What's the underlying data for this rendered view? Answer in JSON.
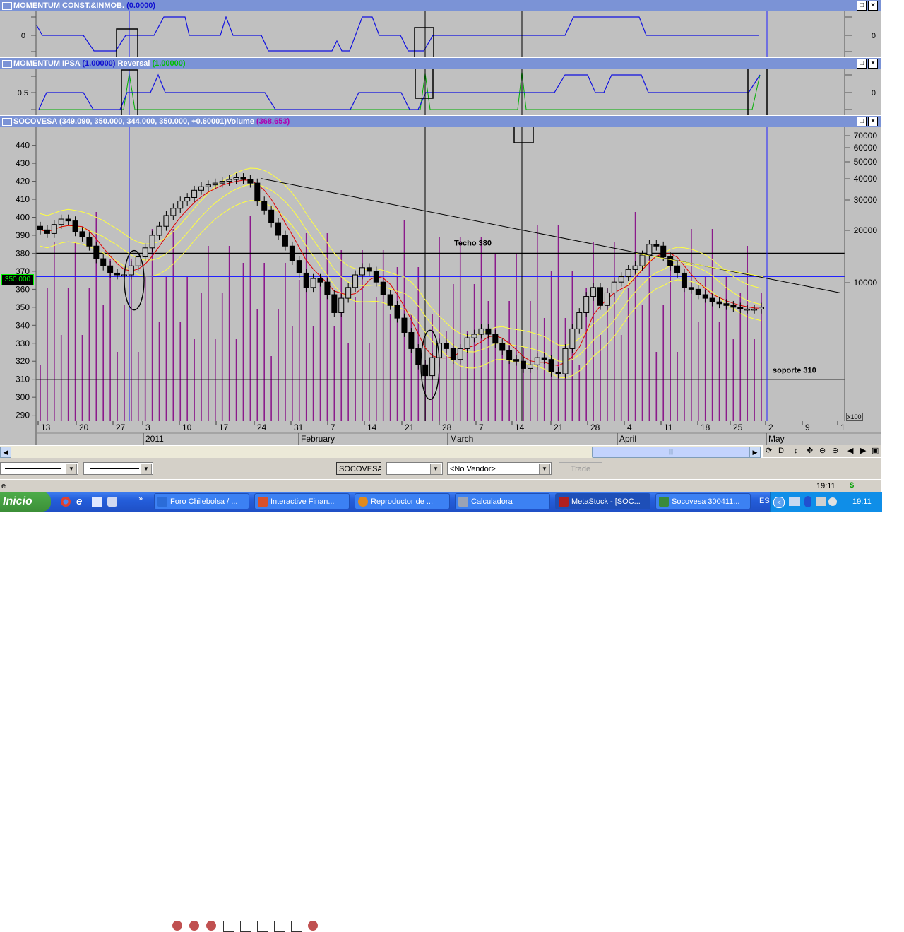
{
  "panels": {
    "momentum_const": {
      "title": "MOMENTUM CONST.&INMOB.",
      "value": "(0.0000)",
      "axis_label": "0",
      "right_label": "0"
    },
    "momentum_ipsa": {
      "title": "MOMENTUM IPSA",
      "value": "(1.00000)",
      "reversal_label": "Reversal",
      "reversal_value": "(1.00000)",
      "axis_label": "0.5",
      "right_label": "0"
    },
    "price": {
      "title": "SOCOVESA",
      "ohlc": "(349.090, 350.000, 344.000, 350.000, +0.60001)",
      "volume_label": "Volume",
      "volume_value": "(368,653)",
      "last_price_tag": "350.000",
      "x100_label": "x100"
    }
  },
  "annotations": {
    "techo": "Techo 380",
    "soporte": "soporte 310"
  },
  "chart_data": [
    {
      "type": "line",
      "title": "MOMENTUM CONST.&INMOB.",
      "y_tick": [
        "0"
      ]
    },
    {
      "type": "line",
      "title": "MOMENTUM IPSA",
      "series": [
        {
          "name": "Reversal",
          "values": [
            1
          ]
        }
      ],
      "y_tick": [
        "0.5"
      ]
    },
    {
      "type": "candlestick",
      "title": "SOCOVESA",
      "ylim": [
        282,
        446
      ],
      "y_ticks": [
        440,
        430,
        420,
        410,
        400,
        390,
        380,
        370,
        360,
        350,
        340,
        330,
        320,
        310,
        300,
        290
      ],
      "volume_ticks": [
        "70000",
        "60000",
        "50000",
        "40000",
        "30000",
        "20000",
        "10000"
      ],
      "x_ticks_days": [
        "13",
        "20",
        "27",
        "3",
        "10",
        "17",
        "24",
        "31",
        "7",
        "14",
        "21",
        "28",
        "7",
        "14",
        "21",
        "28",
        "4",
        "11",
        "18",
        "25",
        "2",
        "9",
        "1"
      ],
      "x_ticks_months": [
        "2011",
        "February",
        "March",
        "April",
        "May"
      ],
      "horizontal_lines": {
        "resistance": 380,
        "support": 310,
        "blue": 367
      },
      "closes": [
        393,
        391,
        396,
        399,
        398,
        392,
        389,
        384,
        377,
        373,
        369,
        368,
        368,
        373,
        378,
        383,
        390,
        395,
        401,
        405,
        409,
        411,
        415,
        417,
        418,
        419,
        420,
        421,
        422,
        421,
        419,
        409,
        404,
        397,
        390,
        384,
        376,
        369,
        361,
        366,
        364,
        357,
        347,
        355,
        361,
        368,
        372,
        370,
        364,
        357,
        351,
        344,
        336,
        327,
        318,
        312,
        322,
        330,
        327,
        321,
        327,
        333,
        335,
        338,
        335,
        330,
        326,
        321,
        320,
        316,
        318,
        322,
        321,
        314,
        313,
        327,
        338,
        347,
        356,
        361,
        351,
        358,
        364,
        367,
        371,
        373,
        379,
        385,
        384,
        378,
        373,
        369,
        361,
        360,
        357,
        355,
        353,
        352,
        351,
        350,
        349,
        349,
        349,
        350
      ]
    }
  ],
  "toolbar": {
    "symbol": "SOCOVESA",
    "empty_combo": "",
    "vendor": "<No Vendor>",
    "trade": "Trade",
    "d_label": "D"
  },
  "statusbar": {
    "left_text": "e",
    "time": "19:11",
    "dollar": "$"
  },
  "taskbar": {
    "start": "Inicio",
    "tasks": [
      {
        "label": "Foro Chilebolsa / ...",
        "icon_color": "#2b6cd8"
      },
      {
        "label": "Interactive Finan...",
        "icon_color": "#d8512b"
      },
      {
        "label": "Reproductor de ...",
        "icon_color": "#e08a1e"
      },
      {
        "label": "Calculadora",
        "icon_color": "#9aa3b5"
      },
      {
        "label": "MetaStock - [SOC...",
        "icon_color": "#b02020"
      },
      {
        "label": "Socovesa 300411...",
        "icon_color": "#3a8a3a"
      }
    ],
    "lang": "ES",
    "clock": "19:11"
  }
}
